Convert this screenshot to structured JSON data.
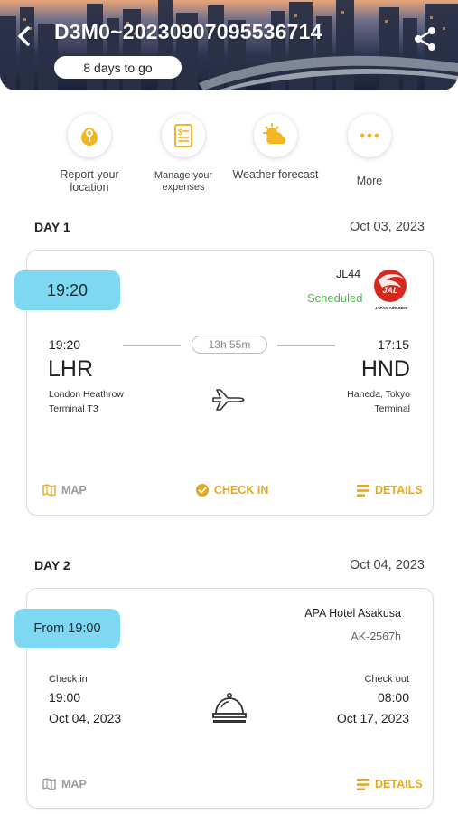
{
  "header": {
    "title": "D3M0~20230907095536714",
    "days_left": "8 days to go"
  },
  "actions": [
    {
      "label": "Report your location",
      "icon": "location-pin-icon"
    },
    {
      "label": "Manage your expenses",
      "icon": "receipt-icon"
    },
    {
      "label": "Weather forecast",
      "icon": "weather-icon"
    },
    {
      "label": "More",
      "icon": "more-dots-icon"
    }
  ],
  "day1": {
    "title": "DAY 1",
    "date": "Oct 03, 2023",
    "flight": {
      "badge_time": "19:20",
      "flight_number": "JL44",
      "status": "Scheduled",
      "airline_logo_text": "JAL",
      "airline_name": "JAPAN AIRLINES",
      "depart_time": "19:20",
      "depart_code": "LHR",
      "depart_airport": "London Heathrow",
      "depart_terminal": "Terminal T3",
      "duration": "13h 55m",
      "arrive_time": "17:15",
      "arrive_code": "HND",
      "arrive_airport": "Haneda, Tokyo",
      "arrive_terminal": "Terminal",
      "map_label": "MAP",
      "checkin_label": "CHECK IN",
      "details_label": "DETAILS"
    }
  },
  "day2": {
    "title": "DAY 2",
    "date": "Oct 04, 2023",
    "hotel": {
      "badge_time": "From 19:00",
      "name": "APA Hotel Asakusa",
      "code": "AK-2567h",
      "checkin_label": "Check in",
      "checkin_time": "19:00",
      "checkin_date": "Oct 04, 2023",
      "checkout_label": "Check out",
      "checkout_time": "08:00",
      "checkout_date": "Oct 17, 2023",
      "map_label": "MAP",
      "details_label": "DETAILS"
    }
  },
  "colors": {
    "accent_gold": "#e6a820",
    "badge_blue": "#7fd8f1",
    "status_green": "#4cbb4c",
    "jal_red": "#d7281e"
  }
}
